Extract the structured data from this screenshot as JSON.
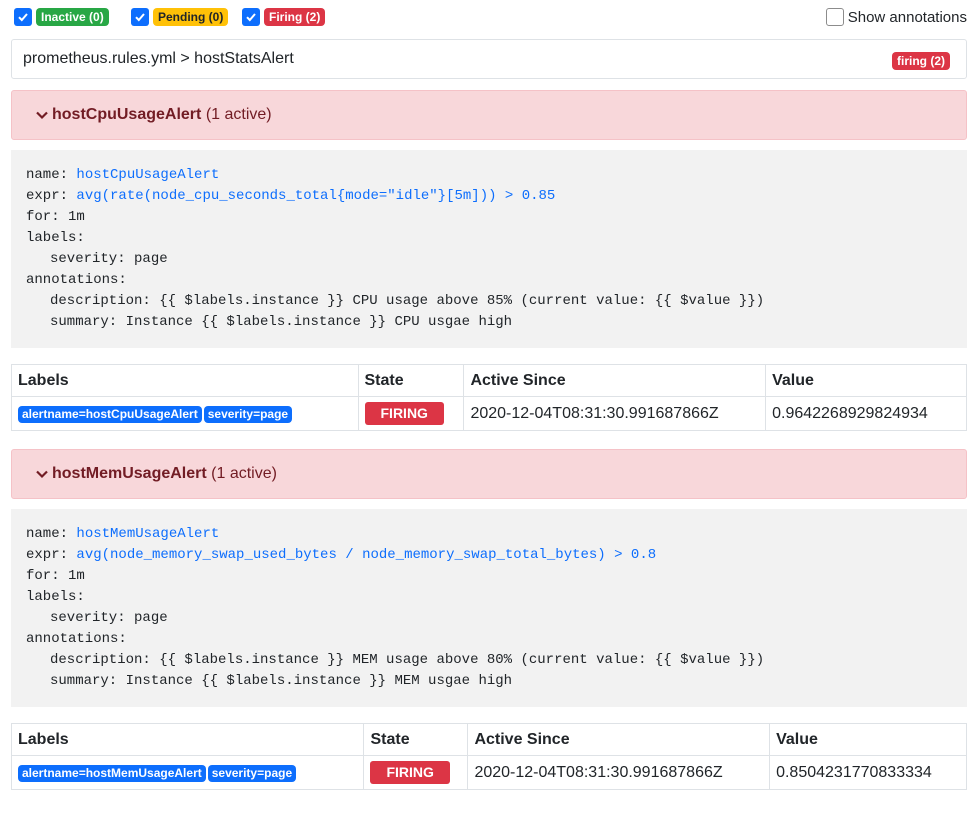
{
  "filters": {
    "inactive": "Inactive (0)",
    "pending": "Pending (0)",
    "firing": "Firing (2)",
    "show_annotations": "Show annotations"
  },
  "group": {
    "title": "prometheus.rules.yml > hostStatsAlert",
    "badge": "firing (2)"
  },
  "alerts": [
    {
      "name": "hostCpuUsageAlert",
      "active": "(1 active)",
      "code": {
        "name_key": "name: ",
        "name_val": "hostCpuUsageAlert",
        "expr_key": "expr: ",
        "expr_val": "avg(rate(node_cpu_seconds_total{mode=\"idle\"}[5m])) > 0.85",
        "for": "for: 1m",
        "labels": "labels:",
        "severity": "severity: page",
        "annotations": "annotations:",
        "description": "description: {{ $labels.instance }} CPU usage above 85% (current value: {{ $value }})",
        "summary": "summary: Instance {{ $labels.instance }} CPU usgae high"
      },
      "table": {
        "headers": [
          "Labels",
          "State",
          "Active Since",
          "Value"
        ],
        "labels": [
          "alertname=hostCpuUsageAlert",
          "severity=page"
        ],
        "state": "FIRING",
        "active_since": "2020-12-04T08:31:30.991687866Z",
        "value": "0.9642268929824934"
      }
    },
    {
      "name": "hostMemUsageAlert",
      "active": "(1 active)",
      "code": {
        "name_key": "name: ",
        "name_val": "hostMemUsageAlert",
        "expr_key": "expr: ",
        "expr_val": "avg(node_memory_swap_used_bytes / node_memory_swap_total_bytes) > 0.8",
        "for": "for: 1m",
        "labels": "labels:",
        "severity": "severity: page",
        "annotations": "annotations:",
        "description": "description: {{ $labels.instance }} MEM usage above 80% (current value: {{ $value }})",
        "summary": "summary: Instance {{ $labels.instance }} MEM usgae high"
      },
      "table": {
        "headers": [
          "Labels",
          "State",
          "Active Since",
          "Value"
        ],
        "labels": [
          "alertname=hostMemUsageAlert",
          "severity=page"
        ],
        "state": "FIRING",
        "active_since": "2020-12-04T08:31:30.991687866Z",
        "value": "0.8504231770833334"
      }
    }
  ],
  "colors": {
    "accent": "#0d6efd",
    "firing": "#dc3545",
    "inactive": "#28a745",
    "pending": "#ffc107",
    "alert_bg": "#f8d7da"
  }
}
